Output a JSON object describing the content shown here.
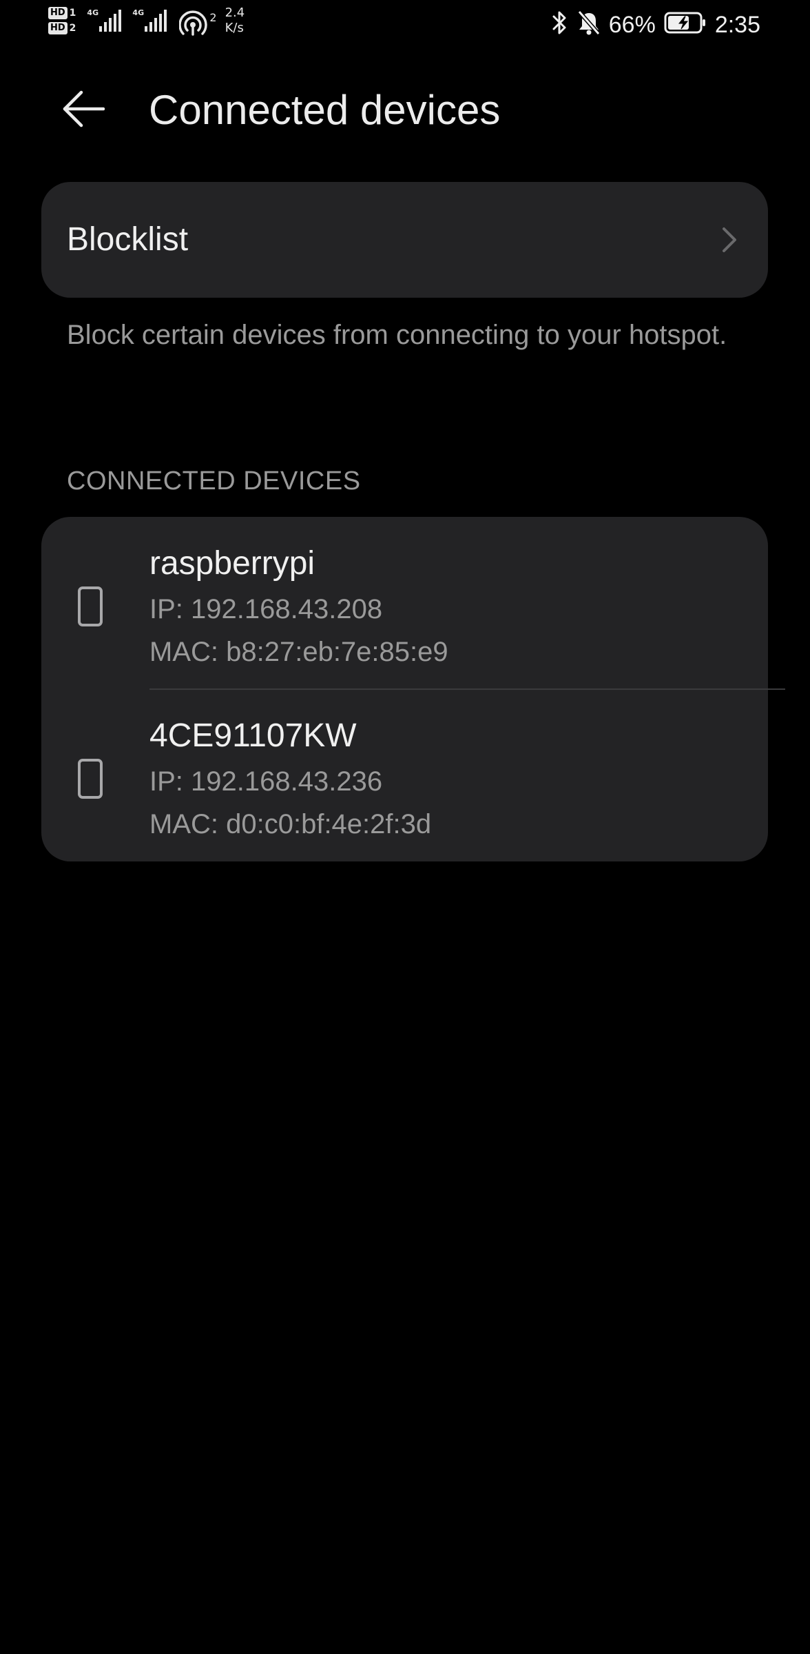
{
  "status_bar": {
    "sim1_badge": "HD",
    "sim1_num": "1",
    "sim2_badge": "HD",
    "sim2_num": "2",
    "network1": "4G",
    "network2": "4G",
    "hotspot_count": "2",
    "speed_value": "2.4",
    "speed_unit": "K/s",
    "battery_percent": "66%",
    "time": "2:35",
    "icons": [
      "bluetooth-icon",
      "silent-bell-icon",
      "battery-charging-icon",
      "hotspot-icon",
      "signal-icon"
    ]
  },
  "header": {
    "back_icon": "arrow-left-icon",
    "title": "Connected devices"
  },
  "blocklist": {
    "label": "Blocklist",
    "chevron_icon": "chevron-right-icon",
    "description": "Block certain devices from connecting to your hotspot."
  },
  "connected": {
    "section_title": "CONNECTED DEVICES",
    "devices": [
      {
        "icon": "phone-icon",
        "name": "raspberrypi",
        "ip": "IP: 192.168.43.208",
        "mac": "MAC: b8:27:eb:7e:85:e9"
      },
      {
        "icon": "phone-icon",
        "name": "4CE91107KW",
        "ip": "IP: 192.168.43.236",
        "mac": "MAC: d0:c0:bf:4e:2f:3d"
      }
    ]
  },
  "colors": {
    "background": "#000000",
    "card": "#232325",
    "primary_text": "#f0f0f0",
    "secondary_text": "#9a9a9a",
    "divider": "#3a3a3c"
  }
}
